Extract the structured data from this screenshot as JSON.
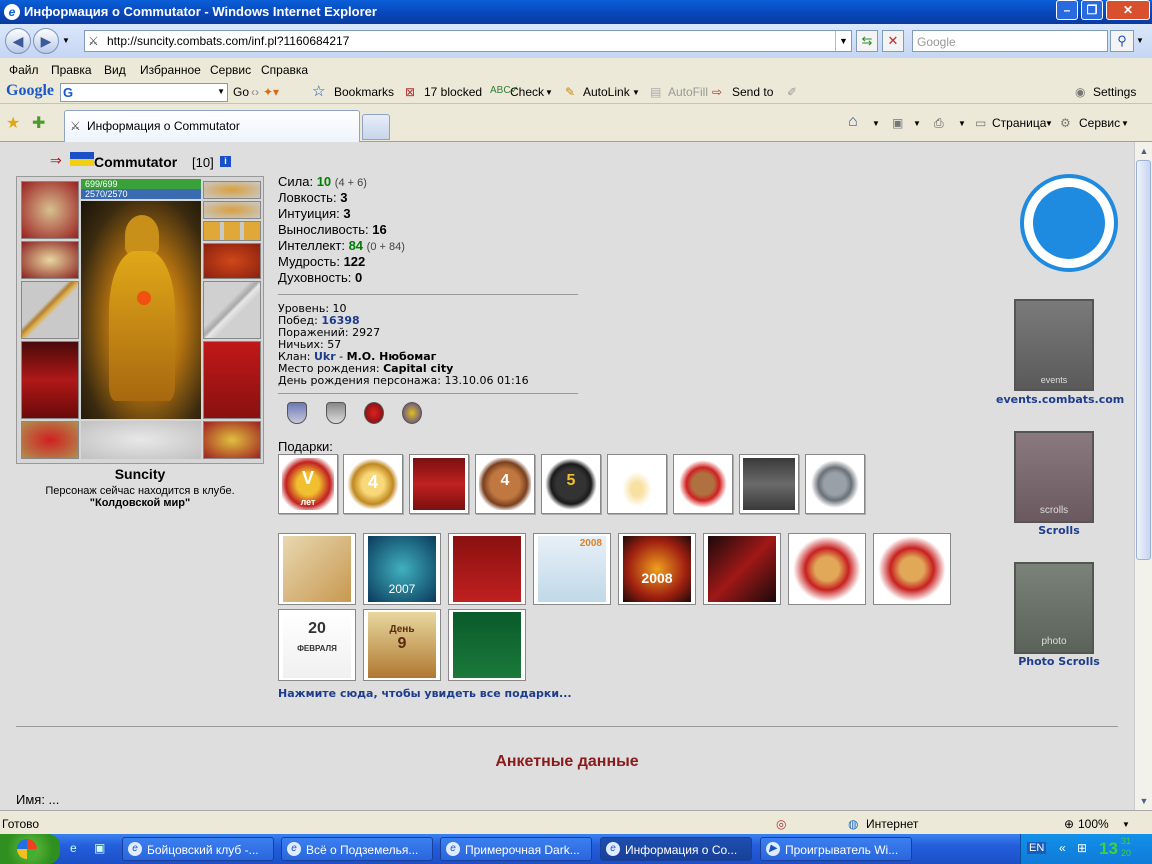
{
  "window": {
    "title": "Информация о Commutator - Windows Internet Explorer"
  },
  "address": {
    "url": "http://suncity.combats.com/inf.pl?1160684217",
    "search_placeholder": "Google"
  },
  "menu": [
    "Файл",
    "Правка",
    "Вид",
    "Избранное",
    "Сервис",
    "Справка"
  ],
  "google_toolbar": {
    "logo": "Google",
    "go": "Go",
    "bookmarks": "Bookmarks",
    "blocked": "17 blocked",
    "check": "Check",
    "autolink": "AutoLink",
    "autofill": "AutoFill",
    "sendto": "Send to",
    "settings": "Settings"
  },
  "tabs": {
    "active_label": "Информация о Commutator",
    "page_cmd": "Страница",
    "tools_cmd": "Сервис"
  },
  "profile": {
    "name": "Commutator",
    "level_tag": "[10]",
    "hp": "699/699",
    "mana": "2570/2570",
    "city": "Suncity",
    "location_text": "Персонаж сейчас находится в клубе.",
    "location_place": "\"Колдовской мир\"",
    "stats": [
      {
        "label": "Сила:",
        "value": "10",
        "extra": "(4 + 6)",
        "green": true
      },
      {
        "label": "Ловкость:",
        "value": "3",
        "extra": "",
        "green": false
      },
      {
        "label": "Интуиция:",
        "value": "3",
        "extra": "",
        "green": false
      },
      {
        "label": "Выносливость:",
        "value": "16",
        "extra": "",
        "green": false
      },
      {
        "label": "Интеллект:",
        "value": "84",
        "extra": "(0 + 84)",
        "green": true
      },
      {
        "label": "Мудрость:",
        "value": "122",
        "extra": "",
        "green": false
      },
      {
        "label": "Духовность:",
        "value": "0",
        "extra": "",
        "green": false
      }
    ],
    "level_label": "Уровень:",
    "level": "10",
    "wins_label": "Побед:",
    "wins": "16398",
    "losses_label": "Поражений:",
    "losses": "2927",
    "draws_label": "Ничьих:",
    "draws": "57",
    "clan_label": "Клан:",
    "clan": "Ukr",
    "clan_rank": "М.О. Нюбомаг",
    "birthplace_label": "Место рождения:",
    "birthplace": "Capital city",
    "birthday_label": "День рождения персонажа:",
    "birthday": "13.10.06 01:16",
    "gifts_label": "Подарки:",
    "gifts_link": "Нажмите сюда, чтобы увидеть все подарки...",
    "anketa_title": "Анкетные данные",
    "name_field": "Имя:  ..."
  },
  "right_links": {
    "events": "events.combats.com",
    "scrolls": "Scrolls",
    "photo": "Photo Scrolls",
    "events_banner_text": "events",
    "scrolls_banner_text": "scrolls",
    "photo_banner_text": "photo"
  },
  "gift_texts": {
    "gift1": "V",
    "gift1_sub": "лет",
    "gift2": "4",
    "gift4": "4",
    "gift5": "5",
    "card2": "2007",
    "card5": "2008",
    "card4": "2008",
    "card8": "20",
    "card8_sub": "ФЕВРАЛЯ",
    "card9": "9",
    "card9_title": "День"
  },
  "status": {
    "ready": "Готово",
    "zone": "Интернет",
    "zoom": "100%"
  },
  "taskbar": {
    "tasks": [
      "Бойцовский клуб -...",
      "Всё о Подземелья...",
      "Примерочная Dark...",
      "Информация о Co...",
      "Проигрыватель Wi..."
    ],
    "lang": "EN",
    "clock": "13",
    "clock_small_top": "31",
    "clock_small_bottom": "20"
  },
  "colors": {
    "accent": "#0a5fd8",
    "green_stat": "#008000",
    "link": "#1e3c8c",
    "anketa": "#8b1a1a"
  }
}
